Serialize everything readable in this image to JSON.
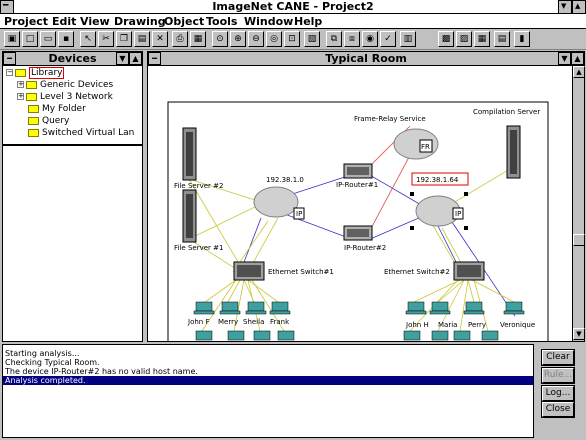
{
  "app": {
    "title": "ImageNet CANE - Project2",
    "system_menu_glyph": "━",
    "minimize_glyph": "▼",
    "maximize_glyph": "▲"
  },
  "menu": [
    {
      "label": "Project"
    },
    {
      "label": "Edit"
    },
    {
      "label": "View"
    },
    {
      "label": "Drawing"
    },
    {
      "label": "Object"
    },
    {
      "label": "Tools"
    },
    {
      "label": "Window"
    },
    {
      "label": "Help"
    }
  ],
  "toolbar": {
    "icons": [
      "run-icon",
      "new-icon",
      "open-icon",
      "save-icon",
      "pointer-icon",
      "cut-icon",
      "copy-icon",
      "paste-icon",
      "delete-icon",
      "print-icon",
      "print-preview-icon",
      "zoom-fit-icon",
      "zoom-in-icon",
      "zoom-out-icon",
      "zoom-area-icon",
      "zoom-page-icon",
      "note-icon",
      "connect-icon",
      "link-icon",
      "view-icon",
      "check-icon",
      "properties-icon",
      "device-icon",
      "port-icon",
      "traffic-icon",
      "report-icon",
      "analyze-icon"
    ]
  },
  "devices_panel": {
    "title": "Devices",
    "tree": [
      {
        "label": "Library",
        "level": 0,
        "expander": "⊟"
      },
      {
        "label": "Generic Devices",
        "level": 1,
        "expander": "⊞"
      },
      {
        "label": "Level 3 Network",
        "level": 1,
        "expander": "⊞"
      },
      {
        "label": "My Folder",
        "level": 1,
        "expander": ""
      },
      {
        "label": "Query",
        "level": 1,
        "expander": ""
      },
      {
        "label": "Switched Virtual Lan",
        "level": 1,
        "expander": ""
      }
    ]
  },
  "diagram_panel": {
    "title": "Typical Room",
    "labels": {
      "frame_relay": "Frame-Relay Service",
      "compilation_server": "Compilation Server",
      "file_server_2": "File Server #2",
      "file_server_1": "File Server #1",
      "cloud_left": "192.38.1.0",
      "cloud_right": "192.38.1.64",
      "router_1": "IP-Router#1",
      "router_2": "IP-Router#2",
      "switch_1": "Ethernet Switch#1",
      "switch_2": "Ethernet Switch#2",
      "fr_badge": "FR",
      "ip_badge": "IP",
      "pc_left": [
        "John F",
        "Merry",
        "Sheila",
        "Frank"
      ],
      "pc_right": [
        "John H",
        "Maria",
        "Perry",
        "Veronique"
      ]
    }
  },
  "log": {
    "lines": [
      {
        "text": "Starting analysis...",
        "selected": false
      },
      {
        "text": "Checking Typical Room.",
        "selected": false
      },
      {
        "text": "The device IP-Router#2 has no valid host name.",
        "selected": false
      },
      {
        "text": "Analysis completed.",
        "selected": true
      }
    ],
    "buttons": [
      {
        "label": "Clear",
        "enabled": true
      },
      {
        "label": "Rule...",
        "enabled": false
      },
      {
        "label": "Log...",
        "enabled": true
      },
      {
        "label": "Close",
        "enabled": true
      }
    ]
  },
  "colors": {
    "selection": "#000080",
    "link_yellow": "#c8c832",
    "link_blue": "#3232c8",
    "link_red": "#e05050",
    "highlight_box": "#e00000"
  }
}
